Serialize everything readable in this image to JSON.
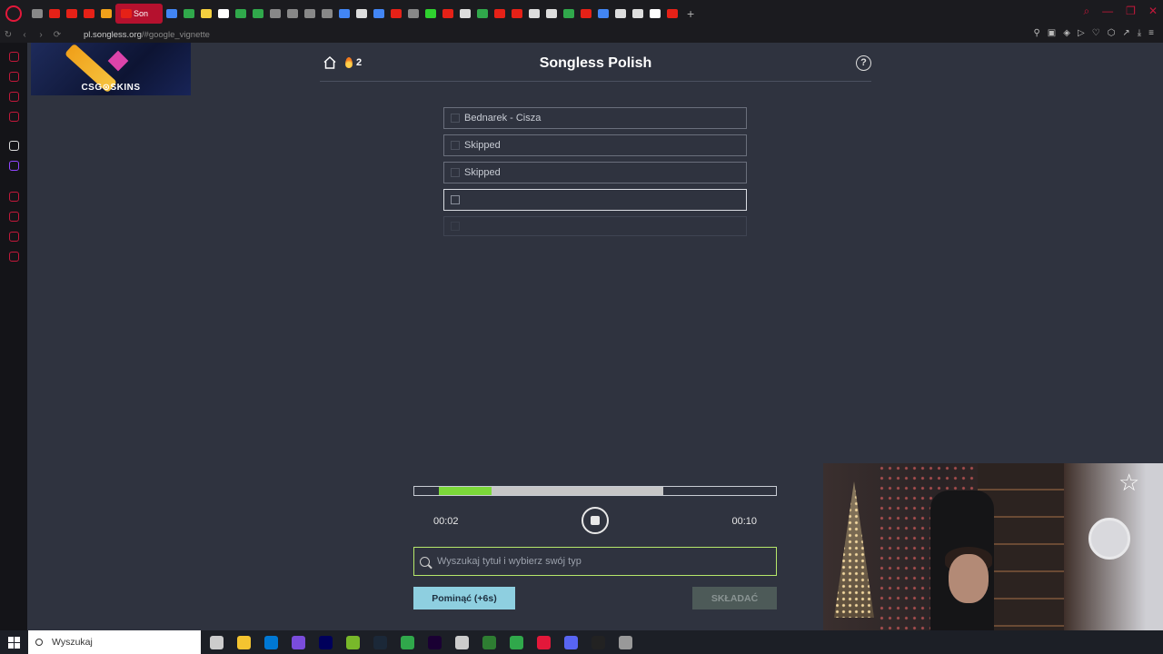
{
  "browser": {
    "active_tab_label": "Son",
    "url_host": "pl.songless.org",
    "url_rest": "/#google_vignette"
  },
  "ad": {
    "text": "CSG⊙SKINS"
  },
  "app": {
    "title": "Songless Polish",
    "streak": "2",
    "help_label": "?"
  },
  "guesses": [
    {
      "text": "Bednarek - Cisza",
      "state": "wrong"
    },
    {
      "text": "Skipped",
      "state": "skipped"
    },
    {
      "text": "Skipped",
      "state": "skipped"
    },
    {
      "text": "",
      "state": "current"
    },
    {
      "text": "",
      "state": "future"
    }
  ],
  "player": {
    "time_current": "00:02",
    "time_total": "00:10",
    "played_fraction": 0.0675,
    "current_end_fraction": 0.2125,
    "unlocked_fraction": 0.6875
  },
  "search": {
    "placeholder": "Wyszukaj tytuł i wybierz swój typ"
  },
  "buttons": {
    "skip": "Pominąć (+6s)",
    "submit": "SKŁADAĆ"
  },
  "taskbar": {
    "search_label": "Wyszukaj"
  },
  "colors": {
    "accent_green": "#7cd93a",
    "skip_button": "#8ecfe0",
    "browser_red": "#c2183a"
  }
}
